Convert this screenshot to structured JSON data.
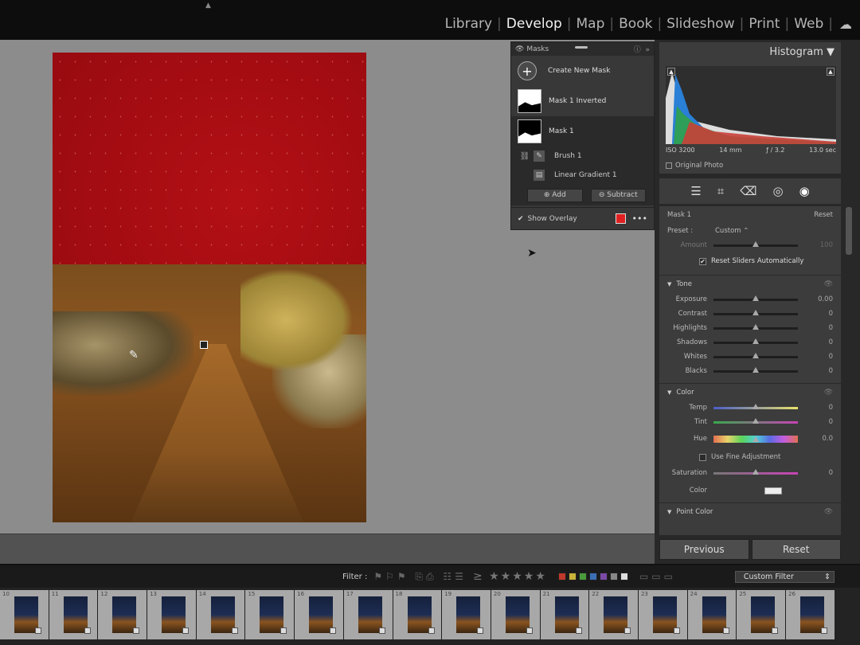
{
  "modules": {
    "items": [
      "Library",
      "Develop",
      "Map",
      "Book",
      "Slideshow",
      "Print",
      "Web"
    ],
    "active": "Develop"
  },
  "masks_panel": {
    "title": "Masks",
    "create_label": "Create New Mask",
    "masks": [
      {
        "name": "Mask 1 Inverted",
        "selected": false
      },
      {
        "name": "Mask 1",
        "selected": true
      }
    ],
    "components": [
      "Brush 1",
      "Linear Gradient 1"
    ],
    "add_label": "Add",
    "subtract_label": "Subtract",
    "show_overlay_label": "Show Overlay",
    "overlay_color": "#e02020"
  },
  "histogram": {
    "title": "Histogram",
    "iso": "ISO 3200",
    "focal": "14 mm",
    "aperture": "ƒ / 3.2",
    "shutter": "13.0 sec",
    "original_photo_label": "Original Photo"
  },
  "mask_settings": {
    "title": "Mask 1",
    "reset_label": "Reset",
    "preset_label": "Preset :",
    "preset_value": "Custom",
    "amount_label": "Amount",
    "amount_value": "100",
    "amount": 0.5,
    "reset_sliders_label": "Reset Sliders Automatically"
  },
  "tone": {
    "title": "Tone",
    "sliders": [
      {
        "label": "Exposure",
        "value": "0.00"
      },
      {
        "label": "Contrast",
        "value": "0"
      },
      {
        "label": "Highlights",
        "value": "0"
      },
      {
        "label": "Shadows",
        "value": "0"
      },
      {
        "label": "Whites",
        "value": "0"
      },
      {
        "label": "Blacks",
        "value": "0"
      }
    ]
  },
  "color": {
    "title": "Color",
    "temp_label": "Temp",
    "temp_value": "0",
    "tint_label": "Tint",
    "tint_value": "0",
    "hue_label": "Hue",
    "hue_value": "0.0",
    "fine_adjust_label": "Use Fine Adjustment",
    "saturation_label": "Saturation",
    "saturation_value": "0",
    "color_label": "Color"
  },
  "point_color": {
    "title": "Point Color"
  },
  "nav": {
    "previous_label": "Previous",
    "reset_label": "Reset"
  },
  "filter": {
    "label": "Filter :",
    "select_value": "Custom Filter",
    "chip_colors": [
      "#c0392b",
      "#c9b23a",
      "#4a9a3c",
      "#3b6fb5",
      "#7b4aa8",
      "#888888",
      "#dddddd"
    ]
  },
  "filmstrip": {
    "numbers": [
      "10",
      "11",
      "12",
      "13",
      "14",
      "15",
      "16",
      "17",
      "18",
      "19",
      "20",
      "21",
      "22",
      "23",
      "24",
      "25",
      "26"
    ]
  }
}
